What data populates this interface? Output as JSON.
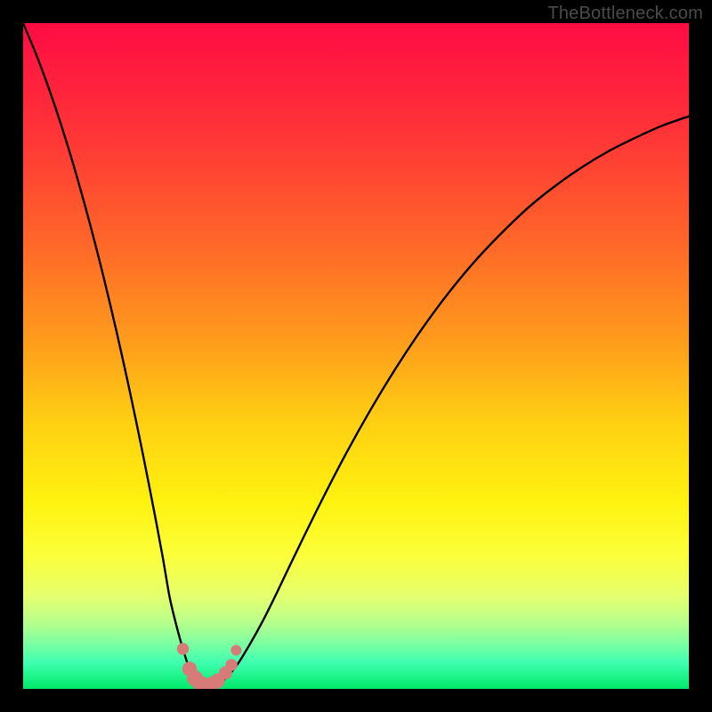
{
  "attribution": "TheBottleneck.com",
  "colors": {
    "background": "#000000",
    "curve_stroke": "#000000",
    "marker_fill": "#d77b79",
    "marker_stroke": "#d77b79",
    "gradient_stops": [
      "#ff0b44",
      "#ff1a3f",
      "#ff3836",
      "#ff6a28",
      "#ff9d1c",
      "#ffd012",
      "#fff210",
      "#fbff3a",
      "#e6ff6e",
      "#b8ff8c",
      "#80ffa0",
      "#40ffb0",
      "#00e96a"
    ]
  },
  "chart_data": {
    "type": "line",
    "title": "",
    "xlabel": "",
    "ylabel": "",
    "xlim": [
      0,
      100
    ],
    "ylim": [
      0,
      100
    ],
    "x": [
      0,
      2,
      4,
      6,
      8,
      10,
      12,
      14,
      16,
      18,
      20,
      21,
      22,
      23,
      24,
      25,
      26,
      27,
      28,
      29,
      30,
      32,
      34,
      36,
      38,
      40,
      44,
      48,
      52,
      56,
      60,
      64,
      68,
      72,
      76,
      80,
      84,
      88,
      92,
      96,
      100
    ],
    "values": [
      100,
      95.2,
      89.8,
      83.8,
      77.2,
      70.0,
      62.2,
      53.8,
      44.8,
      35.2,
      25.0,
      19.6,
      13.8,
      9.6,
      6.0,
      3.0,
      1.4,
      0.6,
      0.4,
      0.6,
      1.2,
      3.4,
      6.6,
      10.2,
      14.2,
      18.4,
      26.6,
      34.4,
      41.6,
      48.2,
      54.2,
      59.6,
      64.4,
      68.6,
      72.4,
      75.6,
      78.4,
      80.8,
      82.8,
      84.6,
      86.0
    ],
    "markers": [
      {
        "x": 24.0,
        "y": 6.0,
        "r": 0.9
      },
      {
        "x": 25.0,
        "y": 3.0,
        "r": 1.1
      },
      {
        "x": 25.8,
        "y": 1.6,
        "r": 1.2
      },
      {
        "x": 26.6,
        "y": 0.8,
        "r": 1.2
      },
      {
        "x": 27.4,
        "y": 0.4,
        "r": 1.2
      },
      {
        "x": 28.2,
        "y": 0.6,
        "r": 1.2
      },
      {
        "x": 29.2,
        "y": 1.2,
        "r": 1.1
      },
      {
        "x": 30.4,
        "y": 2.4,
        "r": 1.0
      },
      {
        "x": 31.3,
        "y": 3.6,
        "r": 0.9
      },
      {
        "x": 32.0,
        "y": 5.8,
        "r": 0.8
      }
    ]
  }
}
